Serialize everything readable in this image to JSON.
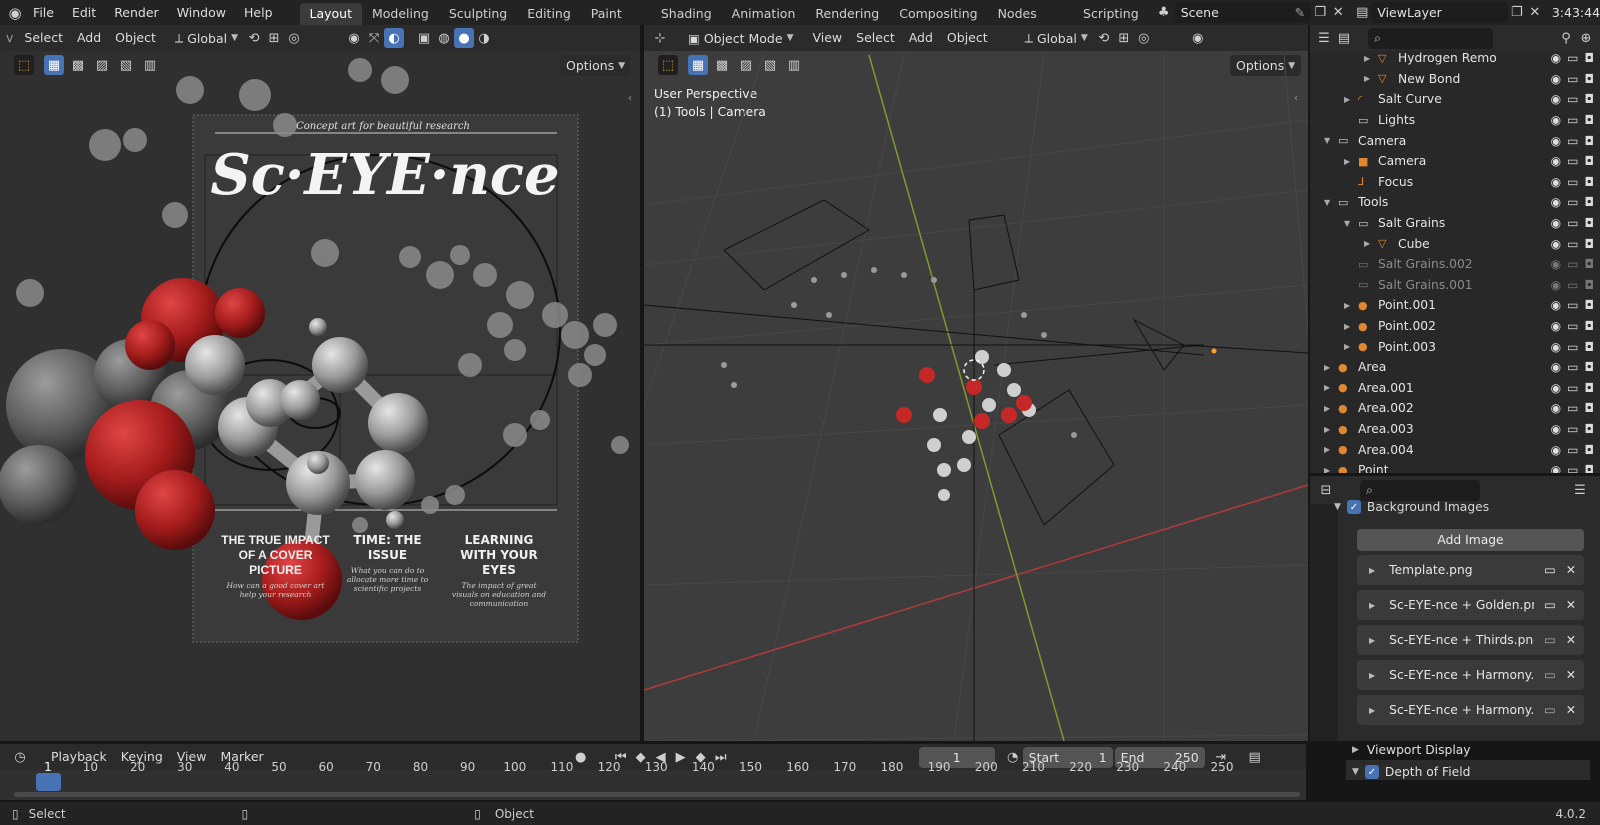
{
  "menu": {
    "items": [
      "File",
      "Edit",
      "Render",
      "Window",
      "Help"
    ]
  },
  "workspaces": [
    "Layout",
    "Modeling",
    "Sculpting",
    "UV Editing",
    "Texture Paint",
    "Shading",
    "Animation",
    "Rendering",
    "Compositing",
    "Geometry Nodes",
    "Scripting"
  ],
  "scene": {
    "name": "Scene"
  },
  "view_layer": {
    "name": "ViewLayer"
  },
  "clock": "3:43:44",
  "left_viewport": {
    "header": {
      "select": "Select",
      "add": "Add",
      "object": "Object",
      "orientation": "Global",
      "options": "Options"
    },
    "poster": {
      "tagline": "Concept art for beautiful research",
      "title": "Sc·EYE·nce",
      "col1_head": "THE TRUE IMPACT OF A COVER PICTURE",
      "col1_sub": "How can a good cover art help your research",
      "col2_head": "TIME: THE ISSUE",
      "col2_sub": "What you can do to allocate more time to scientific projects",
      "col3_head": "LEARNING WITH YOUR EYES",
      "col3_sub": "The impact of great visuals on education and communication"
    }
  },
  "right_viewport": {
    "header": {
      "mode": "Object Mode",
      "view": "View",
      "select": "Select",
      "add": "Add",
      "object": "Object",
      "orientation": "Global",
      "options": "Options"
    },
    "overlay_line1": "User Perspective",
    "overlay_line2": "(1) Tools | Camera"
  },
  "outliner": {
    "rows": [
      {
        "label": "Hydrogen Remo",
        "icon": "mesh-icon",
        "dim": false
      },
      {
        "label": "New Bond",
        "icon": "mesh-icon",
        "dim": false
      },
      {
        "label": "Salt Curve",
        "icon": "curve-icon",
        "dim": false
      },
      {
        "label": "Lights",
        "icon": "collection-icon",
        "dim": false
      },
      {
        "label": "Camera",
        "icon": "collection-icon",
        "dim": false
      },
      {
        "label": "Camera",
        "icon": "camera-icon",
        "dim": false
      },
      {
        "label": "Focus",
        "icon": "empty-icon",
        "dim": false
      },
      {
        "label": "Tools",
        "icon": "collection-icon",
        "dim": false
      },
      {
        "label": "Salt Grains",
        "icon": "collection-icon",
        "dim": false
      },
      {
        "label": "Cube",
        "icon": "mesh-icon",
        "dim": false
      },
      {
        "label": "Salt Grains.002",
        "icon": "collection-icon",
        "dim": true
      },
      {
        "label": "Salt Grains.001",
        "icon": "collection-icon",
        "dim": true
      },
      {
        "label": "Point.001",
        "icon": "light-icon",
        "dim": false
      },
      {
        "label": "Point.002",
        "icon": "light-icon",
        "dim": false
      },
      {
        "label": "Point.003",
        "icon": "light-icon",
        "dim": false
      },
      {
        "label": "Area",
        "icon": "light-icon",
        "dim": false
      },
      {
        "label": "Area.001",
        "icon": "light-icon",
        "dim": false
      },
      {
        "label": "Area.002",
        "icon": "light-icon",
        "dim": false
      },
      {
        "label": "Area.003",
        "icon": "light-icon",
        "dim": false
      },
      {
        "label": "Area.004",
        "icon": "light-icon",
        "dim": false
      },
      {
        "label": "Point",
        "icon": "light-icon",
        "dim": false
      }
    ]
  },
  "properties": {
    "background_images_label": "Background Images",
    "add_image": "Add Image",
    "images": [
      "Template.png",
      "Sc-EYE-nce + Golden.png",
      "Sc-EYE-nce + Thirds.png",
      "Sc-EYE-nce + Harmony...",
      "Sc-EYE-nce + Harmony..."
    ],
    "viewport_display": "Viewport Display",
    "depth_of_field": "Depth of Field"
  },
  "timeline": {
    "playback": "Playback",
    "keying": "Keying",
    "view": "View",
    "marker": "Marker",
    "current_frame": "1",
    "start_label": "Start",
    "start": "1",
    "end_label": "End",
    "end": "250",
    "ticks": [
      "1",
      "10",
      "20",
      "30",
      "40",
      "50",
      "60",
      "70",
      "80",
      "90",
      "100",
      "110",
      "120",
      "130",
      "140",
      "150",
      "160",
      "170",
      "180",
      "190",
      "200",
      "210",
      "220",
      "230",
      "240",
      "250"
    ]
  },
  "status": {
    "select": "Select",
    "object": "Object",
    "version": "4.0.2"
  },
  "colors": {
    "accent": "#4772b3",
    "bg": "#161616",
    "panel": "#2b2b2b",
    "red_axis": "#b33a3a",
    "green_axis": "#7e9b2e"
  }
}
